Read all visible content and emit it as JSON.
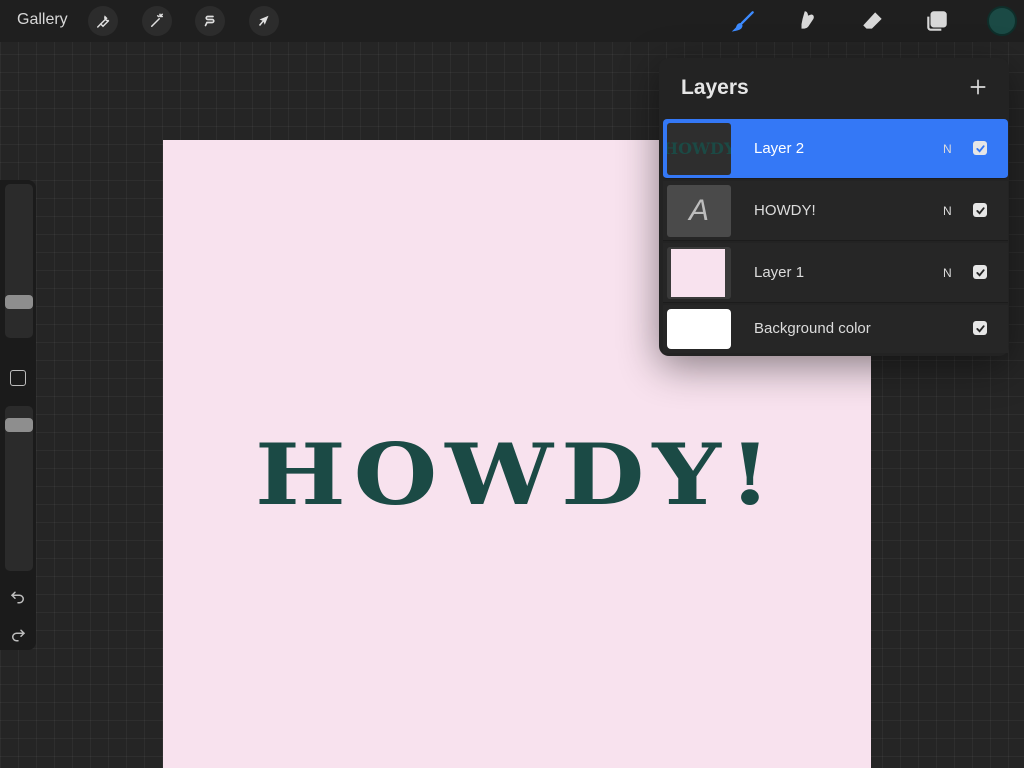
{
  "topbar": {
    "gallery_label": "Gallery",
    "left_tools": [
      {
        "name": "actions",
        "icon": "wrench-icon"
      },
      {
        "name": "adjustments",
        "icon": "magic-wand-icon"
      },
      {
        "name": "selection",
        "icon": "selection-s-icon"
      },
      {
        "name": "transform",
        "icon": "arrow-cursor-icon"
      }
    ],
    "right_tools": [
      {
        "name": "brush",
        "icon": "brush-icon",
        "active": true
      },
      {
        "name": "smudge",
        "icon": "smudge-icon",
        "active": false
      },
      {
        "name": "eraser",
        "icon": "eraser-icon",
        "active": false
      },
      {
        "name": "layers",
        "icon": "layers-icon",
        "active": false
      }
    ],
    "current_color": "#1b4a45"
  },
  "sidebar": {
    "brush_size_icon": "slider-thumb",
    "opacity_icon": "slider-thumb",
    "modify_icon": "square-icon",
    "undo_icon": "undo-icon",
    "redo_icon": "redo-icon"
  },
  "canvas": {
    "background": "#f8e2ee",
    "text": "HOWDY!",
    "text_color": "#1b4a45"
  },
  "layers_panel": {
    "title": "Layers",
    "add_icon": "plus-icon",
    "layers": [
      {
        "name": "Layer 2",
        "mode": "N",
        "visible": true,
        "active": true,
        "thumb": "howdy-raster"
      },
      {
        "name": "HOWDY!",
        "mode": "N",
        "visible": true,
        "active": false,
        "thumb": "text-A"
      },
      {
        "name": "Layer 1",
        "mode": "N",
        "visible": true,
        "active": false,
        "thumb": "pink-fill"
      },
      {
        "name": "Background color",
        "mode": "",
        "visible": true,
        "active": false,
        "thumb": "white-fill"
      }
    ]
  },
  "colors": {
    "accent": "#3478f6",
    "canvas_pink": "#f8e2ee",
    "ink_green": "#1b4a45"
  }
}
